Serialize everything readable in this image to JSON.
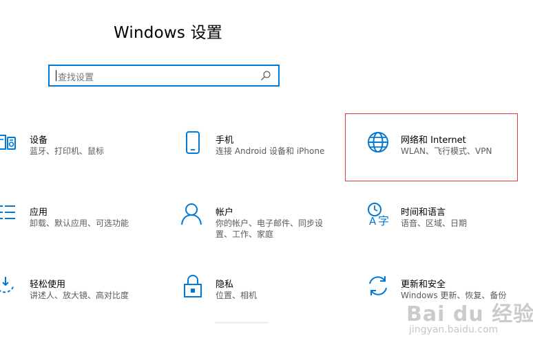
{
  "window": {
    "title": "Windows 设置"
  },
  "search": {
    "placeholder": "查找设置"
  },
  "tiles": [
    {
      "name": "设备",
      "desc": [
        "蓝牙、打印机、鼠标"
      ],
      "icon": "devices-icon"
    },
    {
      "name": "手机",
      "desc": [
        "连接 Android 设备和 iPhone"
      ],
      "icon": "phone-icon"
    },
    {
      "name": "网络和 Internet",
      "desc": [
        "WLAN、飞行模式、VPN"
      ],
      "icon": "globe-icon"
    },
    {
      "name": "应用",
      "desc": [
        "卸载、默认应用、可选功能"
      ],
      "icon": "apps-list-icon"
    },
    {
      "name": "帐户",
      "desc": [
        "你的帐户、电子邮件、同步设",
        "置、工作、家庭"
      ],
      "icon": "person-icon"
    },
    {
      "name": "时间和语言",
      "desc": [
        "语音、区域、日期"
      ],
      "icon": "time-language-icon"
    },
    {
      "name": "轻松使用",
      "desc": [
        "讲述人、放大镜、高对比度"
      ],
      "icon": "ease-of-access-icon"
    },
    {
      "name": "隐私",
      "desc": [
        "位置、相机"
      ],
      "icon": "lock-icon"
    },
    {
      "name": "更新和安全",
      "desc": [
        "Windows 更新、恢复、备份"
      ],
      "icon": "sync-icon"
    }
  ],
  "watermark": {
    "brand": "Bai du 经验",
    "url": "jingyan.baidu.com"
  },
  "colors": {
    "accent": "#0078d7",
    "selection_outline": "#e03c3c"
  }
}
